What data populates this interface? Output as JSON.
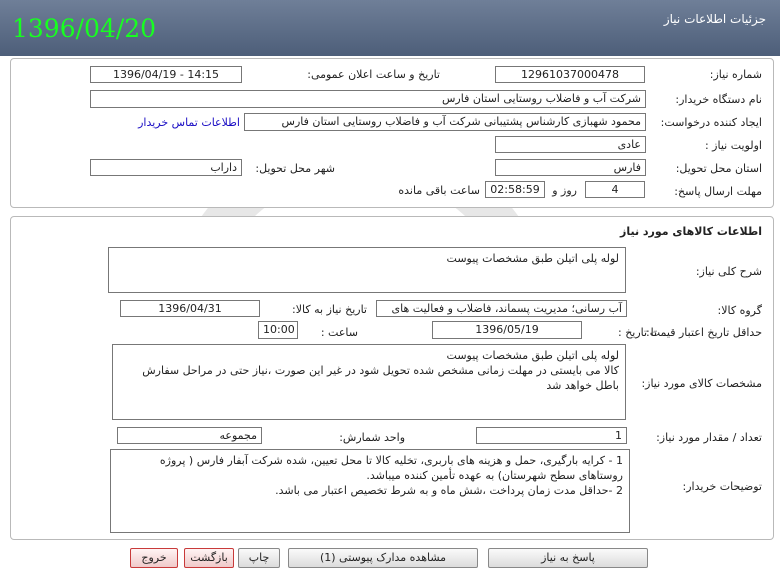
{
  "header": {
    "title": "جزئیات اطلاعات نیاز",
    "date_stamp": "1396/04/20"
  },
  "need_info": {
    "need_number_label": "شماره نیاز:",
    "need_number": "1296103700047‎8",
    "announce_label": "تاریخ و ساعت اعلان عمومی:",
    "announce_value": "1396/04/19 - 14:15",
    "buyer_org_label": "نام دستگاه خریدار:",
    "buyer_org": "شرکت آب و فاضلاب روستایی استان فارس",
    "creator_label": "ایجاد کننده درخواست:",
    "creator": "محمود  شهبازی کارشناس پشتیبانی شرکت آب و فاضلاب روستایی استان فارس",
    "contact_link": "اطلاعات تماس خریدار",
    "priority_label": "اولویت نیاز :",
    "priority": "عادی",
    "province_label": "استان محل تحویل:",
    "province": "فارس",
    "city_label": "شهر محل تحویل:",
    "city": "داراب",
    "deadline_label": "مهلت ارسال پاسخ:",
    "days": "4",
    "days_unit": "روز و",
    "time_left": "02:58:59",
    "time_left_suffix": "ساعت باقی مانده"
  },
  "goods": {
    "section_title": "اطلاعات کالاهای مورد نیاز",
    "general_desc_label": "شرح کلی نیاز:",
    "general_desc": "لوله پلی اتیلن طبق مشخصات پیوست",
    "group_label": "گروه کالا:",
    "group_value": "آب رسانی؛ مدیریت پسماند، فاضلاب و فعالیت های",
    "need_date_label": "تاریخ نیاز به کالا:",
    "need_date": "1396/04/31",
    "min_validity_label": "حداقل تاریخ اعتبار قیمت:",
    "until_date_label": "تا تاریخ :",
    "until_date": "1396/05/19",
    "time_label": "ساعت :",
    "time_value": "10:00",
    "spec_label": "مشخصات کالای مورد نیاز:",
    "spec_text": "لوله پلی اتیلن طبق مشخصات پیوست\nکالا می بایستی در مهلت زمانی مشخص شده تحویل شود در غیر این صورت ،نیاز حتی در مراحل سفارش باطل خواهد شد",
    "qty_label": "تعداد / مقدار مورد نیاز:",
    "qty_value": "1",
    "unit_label": "واحد شمارش:",
    "unit_value": "مجموعه",
    "buyer_notes_label": "توضیحات خریدار:",
    "buyer_notes": "1 - کرایه بارگیری، حمل و هزینه های باربری، تخلیه کالا تا محل تعیین، شده شرکت آبفار فارس ( پروژه روستاهای سطح شهرستان) به عهده تأمین کننده میباشد.\n2 -حداقل مدت زمان پرداخت ،شش ماه و به شرط تخصیص اعتبار می باشد."
  },
  "buttons": {
    "reply": "پاسخ به نیاز",
    "view_docs": "مشاهده مدارک پیوستی (1)",
    "print": "چاپ",
    "back": "بازگشت",
    "exit": "خروج"
  }
}
